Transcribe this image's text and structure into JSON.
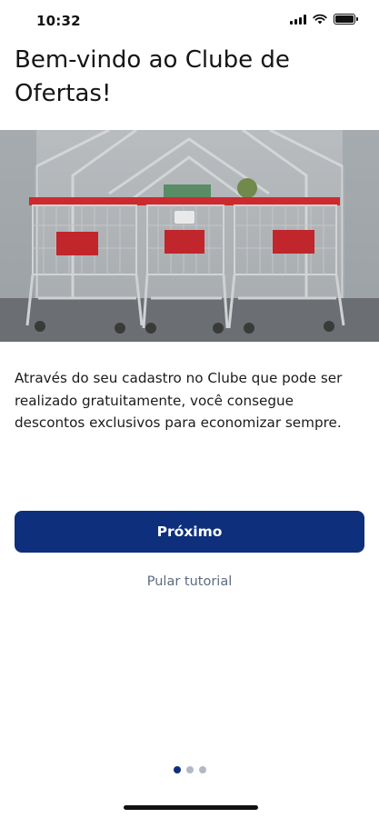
{
  "status_bar": {
    "time": "10:32",
    "icons": [
      "signal-icon",
      "wifi-icon",
      "battery-icon"
    ]
  },
  "onboarding": {
    "title": "Bem-vindo ao Clube de Ofertas!",
    "hero_image": "shopping-carts-photo",
    "description": "Através do seu cadastro no Clube que pode ser realizado gratuitamente, você consegue descontos exclusivos para economizar sempre.",
    "primary_button": "Próximo",
    "skip_link": "Pular tutorial"
  },
  "pager": {
    "total": 3,
    "current": 1
  },
  "colors": {
    "primary": "#0d2f7c",
    "link": "#5c6b82",
    "dot_inactive": "#b3b9c4",
    "text": "#151515"
  }
}
